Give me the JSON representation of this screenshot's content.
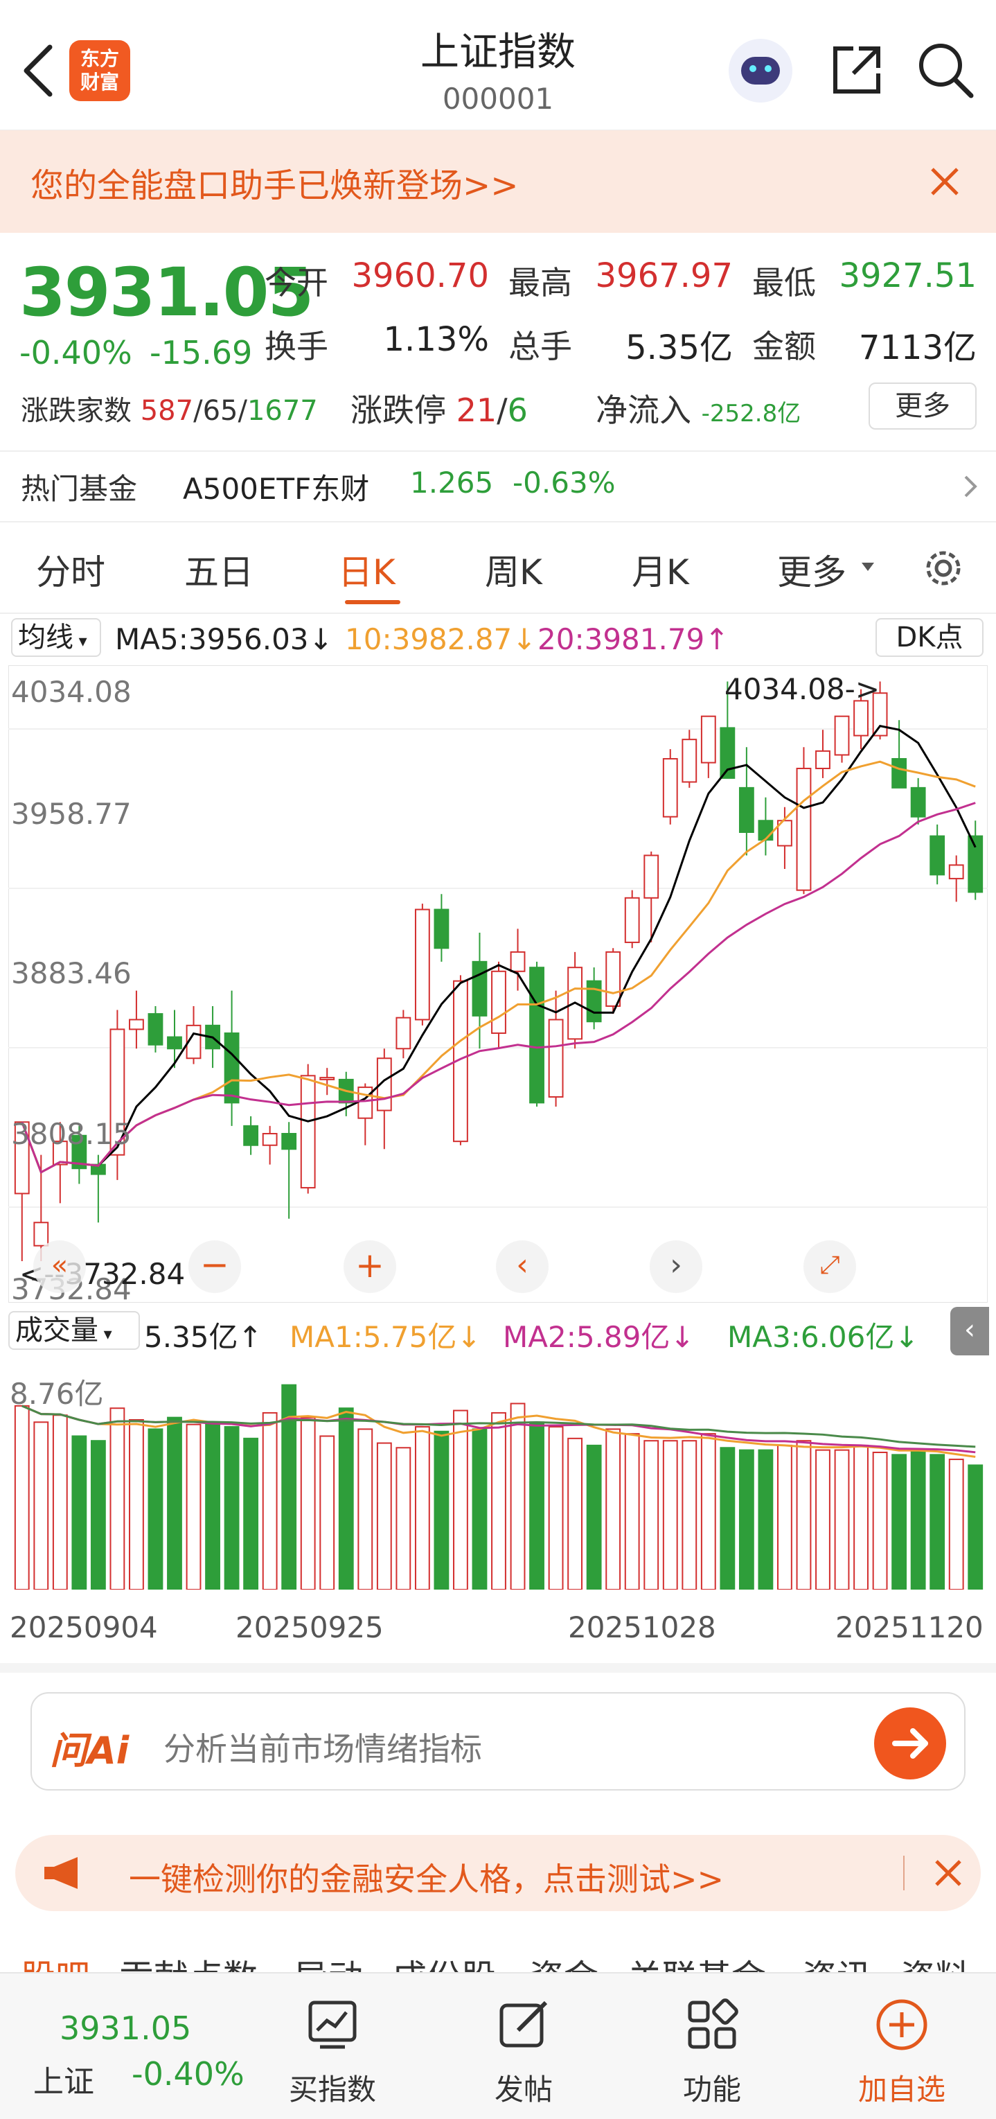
{
  "header": {
    "title": "上证指数",
    "code": "000001",
    "logo_text": "东方财富"
  },
  "banner": {
    "text": "您的全能盘口助手已焕新登场>>"
  },
  "quote": {
    "price": "3931.05",
    "change_pct": "-0.40%",
    "change": "-15.69",
    "open_label": "今开",
    "open": "3960.70",
    "high_label": "最高",
    "high": "3967.97",
    "low_label": "最低",
    "low": "3927.51",
    "turnover_label": "换手",
    "turnover": "1.13%",
    "volume_label": "总手",
    "volume": "5.35亿",
    "amount_label": "金额",
    "amount": "7113亿",
    "breadth_label": "涨跌家数",
    "breadth_up": "587",
    "breadth_flat": "65",
    "breadth_down": "1677",
    "sep": "/",
    "limit_label": "涨跌停",
    "limit_up": "21",
    "limit_down": "6",
    "netflow_label": "净流入",
    "netflow": "-252.8亿",
    "more_label": "更多"
  },
  "hot_fund": {
    "label": "热门基金",
    "name": "A500ETF东财",
    "price": "1.265",
    "change": "-0.63%"
  },
  "tabs": [
    "分时",
    "五日",
    "日K",
    "周K",
    "月K",
    "更多"
  ],
  "active_tab": "日K",
  "ma_bar": {
    "selector": "均线",
    "ma5": "MA5:3956.03↓",
    "ma10": "10:3982.87↓",
    "ma20": "20:3981.79↑",
    "dk": "DK点"
  },
  "kline": {
    "y_labels": [
      "4034.08",
      "3958.77",
      "3883.46",
      "3808.15",
      "3732.84"
    ],
    "max_annotation": "4034.08->",
    "min_annotation": "<--3732.84"
  },
  "volume_bar": {
    "selector": "成交量",
    "vol": "5.35亿↑",
    "ma1": "MA1:5.75亿↓",
    "ma2": "MA2:5.89亿↓",
    "ma3": "MA3:6.06亿↓",
    "max_label": "8.76亿"
  },
  "dates": [
    "20250904",
    "20250925",
    "20251028",
    "20251120"
  ],
  "ai": {
    "brand": "问Ai",
    "placeholder": "分析当前市场情绪指标"
  },
  "notice": {
    "text": "一键检测你的金融安全人格，点击测试>>"
  },
  "sub_tabs": [
    "股吧",
    "贡献点数",
    "异动",
    "成份股",
    "资金",
    "关联基金",
    "资讯",
    "资料"
  ],
  "bottom": {
    "price": "3931.05",
    "name": "上证",
    "change": "-0.40%",
    "buy_label": "买指数",
    "post_label": "发帖",
    "func_label": "功能",
    "add_label": "加自选"
  },
  "colors": {
    "up": "#d32f2f",
    "down": "#2e9e3a",
    "accent": "#e2581c",
    "ma5": "#000000",
    "ma10": "#f0a030",
    "ma20": "#c2308f"
  },
  "chart_data": {
    "type": "candlestick",
    "ylim": [
      3732.84,
      4034.08
    ],
    "candles": [
      [
        3775,
        3812,
        3740,
        3812
      ],
      [
        3748,
        3795,
        3740,
        3760
      ],
      [
        3790,
        3812,
        3770,
        3802
      ],
      [
        3805,
        3810,
        3780,
        3788
      ],
      [
        3790,
        3795,
        3760,
        3785
      ],
      [
        3795,
        3870,
        3782,
        3860
      ],
      [
        3860,
        3880,
        3850,
        3865
      ],
      [
        3868,
        3872,
        3848,
        3852
      ],
      [
        3856,
        3870,
        3840,
        3850
      ],
      [
        3845,
        3872,
        3842,
        3862
      ],
      [
        3862,
        3872,
        3840,
        3850
      ],
      [
        3858,
        3880,
        3810,
        3822
      ],
      [
        3810,
        3815,
        3795,
        3800
      ],
      [
        3800,
        3810,
        3790,
        3806
      ],
      [
        3806,
        3812,
        3762,
        3798
      ],
      [
        3778,
        3842,
        3775,
        3836
      ],
      [
        3834,
        3840,
        3826,
        3835
      ],
      [
        3834,
        3838,
        3815,
        3822
      ],
      [
        3814,
        3832,
        3800,
        3830
      ],
      [
        3818,
        3850,
        3798,
        3845
      ],
      [
        3850,
        3870,
        3845,
        3866
      ],
      [
        3865,
        3925,
        3862,
        3922
      ],
      [
        3922,
        3930,
        3895,
        3902
      ],
      [
        3802,
        3888,
        3800,
        3885
      ],
      [
        3895,
        3910,
        3850,
        3867
      ],
      [
        3858,
        3895,
        3850,
        3890
      ],
      [
        3890,
        3912,
        3880,
        3900
      ],
      [
        3892,
        3895,
        3820,
        3822
      ],
      [
        3825,
        3880,
        3820,
        3865
      ],
      [
        3855,
        3900,
        3850,
        3892
      ],
      [
        3885,
        3892,
        3860,
        3864
      ],
      [
        3872,
        3902,
        3868,
        3900
      ],
      [
        3905,
        3932,
        3902,
        3928
      ],
      [
        3928,
        3952,
        3905,
        3950
      ],
      [
        3970,
        4005,
        3966,
        4000
      ],
      [
        3988,
        4015,
        3985,
        4010
      ],
      [
        3998,
        4022,
        3990,
        4022
      ],
      [
        4016,
        4040,
        4000,
        3990
      ],
      [
        3985,
        4006,
        3950,
        3962
      ],
      [
        3968,
        3980,
        3950,
        3958
      ],
      [
        3955,
        3975,
        3943,
        3968
      ],
      [
        3932,
        4006,
        3930,
        3995
      ],
      [
        3995,
        4015,
        3990,
        4004
      ],
      [
        4002,
        4022,
        3998,
        4022
      ],
      [
        4012,
        4036,
        4005,
        4030
      ],
      [
        4012,
        4040,
        4010,
        4034
      ],
      [
        4000,
        4020,
        3990,
        3985
      ],
      [
        3985,
        3990,
        3966,
        3970
      ],
      [
        3960,
        3966,
        3935,
        3940
      ],
      [
        3938,
        3950,
        3926,
        3945
      ],
      [
        3960,
        3968,
        3927,
        3931
      ]
    ],
    "volumes": [
      7.9,
      7.2,
      7.5,
      6.6,
      6.4,
      7.8,
      7.3,
      6.9,
      7.4,
      7.1,
      7.2,
      7.0,
      6.5,
      7.6,
      8.8,
      7.4,
      6.6,
      7.8,
      6.9,
      6.3,
      6.1,
      7.0,
      6.8,
      7.7,
      6.9,
      7.6,
      8.0,
      7.2,
      7.0,
      6.5,
      6.2,
      6.9,
      6.7,
      6.4,
      6.4,
      6.4,
      6.7,
      6.1,
      6.0,
      6.0,
      6.2,
      6.4,
      6.0,
      6.0,
      6.2,
      5.9,
      5.8,
      6.0,
      5.8,
      5.6,
      5.35
    ]
  }
}
